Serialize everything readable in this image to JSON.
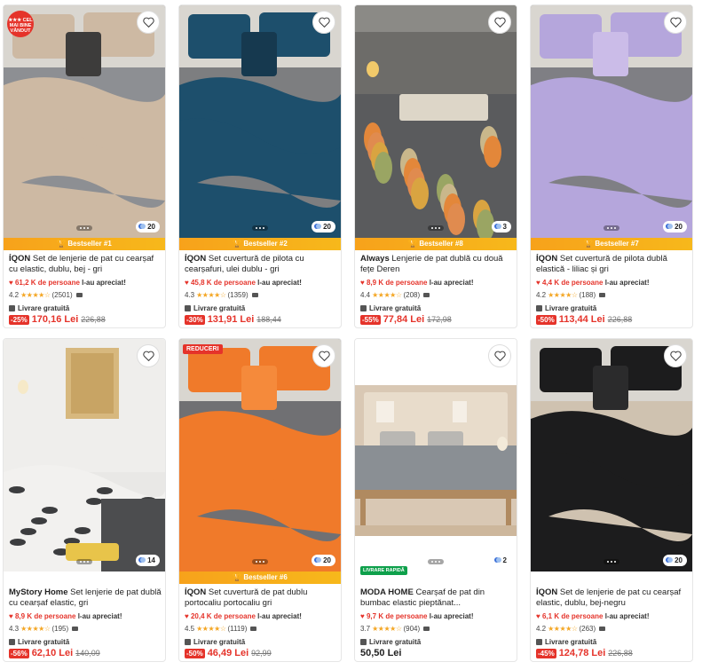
{
  "products": [
    {
      "brand": "ÍQON",
      "title": "Set de lenjerie de pat cu cearșaf cu elastic, dublu, bej - gri",
      "bestseller": "Bestseller #1",
      "liked_count": "61,2 K de persoane",
      "liked_suffix": "l-au apreciat!",
      "rating": "4.2",
      "reviews": "(2501)",
      "shipping": "Livrare gratuită",
      "discount": "-25%",
      "price": "170,16 Lei",
      "old_price": "226,88",
      "images": "20",
      "top_badge": "CEL MAI BINE VÂNDUT",
      "colors": {
        "a": "#cdb9a3",
        "b": "#8d8f93",
        "c": "#3d3c3b"
      }
    },
    {
      "brand": "ÍQON",
      "title": "Set cuvertură de pilota cu cearșafuri, ulei dublu - gri",
      "bestseller": "Bestseller #2",
      "liked_count": "45,8 K de persoane",
      "liked_suffix": "l-au apreciat!",
      "rating": "4.3",
      "reviews": "(1359)",
      "shipping": "Livrare gratuită",
      "discount": "-30%",
      "price": "131,91 Lei",
      "old_price": "188,44",
      "images": "20",
      "colors": {
        "a": "#1d4f6c",
        "b": "#7d7e80",
        "c": "#16394f"
      }
    },
    {
      "brand": "Always",
      "title": "Lenjerie de pat dublă cu două fețe Deren",
      "bestseller": "Bestseller #8",
      "liked_count": "8,9 K de persoane",
      "liked_suffix": "l-au apreciat!",
      "rating": "4.4",
      "reviews": "(208)",
      "shipping": "Livrare gratuită",
      "discount": "-55%",
      "price": "77,84 Lei",
      "old_price": "172,98",
      "images": "3",
      "colors": {
        "a": "#5a5b5d",
        "b": "#e3873a",
        "c": "#c9b78b"
      }
    },
    {
      "brand": "ÍQON",
      "title": "Set cuvertură de pilota dublă elastică - liliac și gri",
      "bestseller": "Bestseller #7",
      "liked_count": "4,4 K de persoane",
      "liked_suffix": "l-au apreciat!",
      "rating": "4.2",
      "reviews": "(188)",
      "shipping": "Livrare gratuită",
      "discount": "-50%",
      "price": "113,44 Lei",
      "old_price": "226,88",
      "images": "20",
      "colors": {
        "a": "#b5a6dc",
        "b": "#7f7f84",
        "c": "#cbbce8"
      }
    },
    {
      "brand": "MyStory Home",
      "title": "Set lenjerie de pat dublă cu cearșaf elastic, gri",
      "liked_count": "8,9 K de persoane",
      "liked_suffix": "l-au apreciat!",
      "rating": "4.3",
      "reviews": "(195)",
      "shipping": "Livrare gratuită",
      "discount": "-56%",
      "price": "62,10 Lei",
      "old_price": "140,09",
      "images": "14",
      "colors": {
        "a": "#e9e8e6",
        "b": "#4c4d4f",
        "c": "#e8c44a"
      }
    },
    {
      "brand": "ÍQON",
      "title": "Set cuvertură de pat dublu portocaliu portocaliu gri",
      "bestseller": "Bestseller #6",
      "liked_count": "20,4 K de persoane",
      "liked_suffix": "l-au apreciat!",
      "rating": "4.5",
      "reviews": "(1119)",
      "shipping": "Livrare gratuită",
      "discount": "-50%",
      "price": "46,49 Lei",
      "old_price": "92,99",
      "images": "20",
      "top_badge": "REDUCERI",
      "colors": {
        "a": "#f07a2a",
        "b": "#707073",
        "c": "#f58a3b"
      }
    },
    {
      "brand": "MODA HOME",
      "title": "Cearșaf de pat din bumbac elastic pieptănat...",
      "liked_count": "9,7 K de persoane",
      "liked_suffix": "l-au apreciat!",
      "rating": "3.7",
      "reviews": "(904)",
      "shipping": "Livrare gratuită",
      "price": "50,50 Lei",
      "images": "2",
      "green_tag": "LIVRARE RAPIDĂ",
      "colors": {
        "a": "#8a8f94",
        "b": "#d9c8b4",
        "c": "#b08a60"
      }
    },
    {
      "brand": "ÍQON",
      "title": "Set de lenjerie de pat cu cearșaf elastic, dublu, bej-negru",
      "liked_count": "6,1 K de persoane",
      "liked_suffix": "l-au apreciat!",
      "rating": "4.2",
      "reviews": "(263)",
      "shipping": "Livrare gratuită",
      "discount": "-45%",
      "price": "124,78 Lei",
      "old_price": "226,88",
      "images": "20",
      "colors": {
        "a": "#1c1c1d",
        "b": "#cfc2b0",
        "c": "#2b2b2c"
      }
    }
  ],
  "stars": "★★★★☆"
}
